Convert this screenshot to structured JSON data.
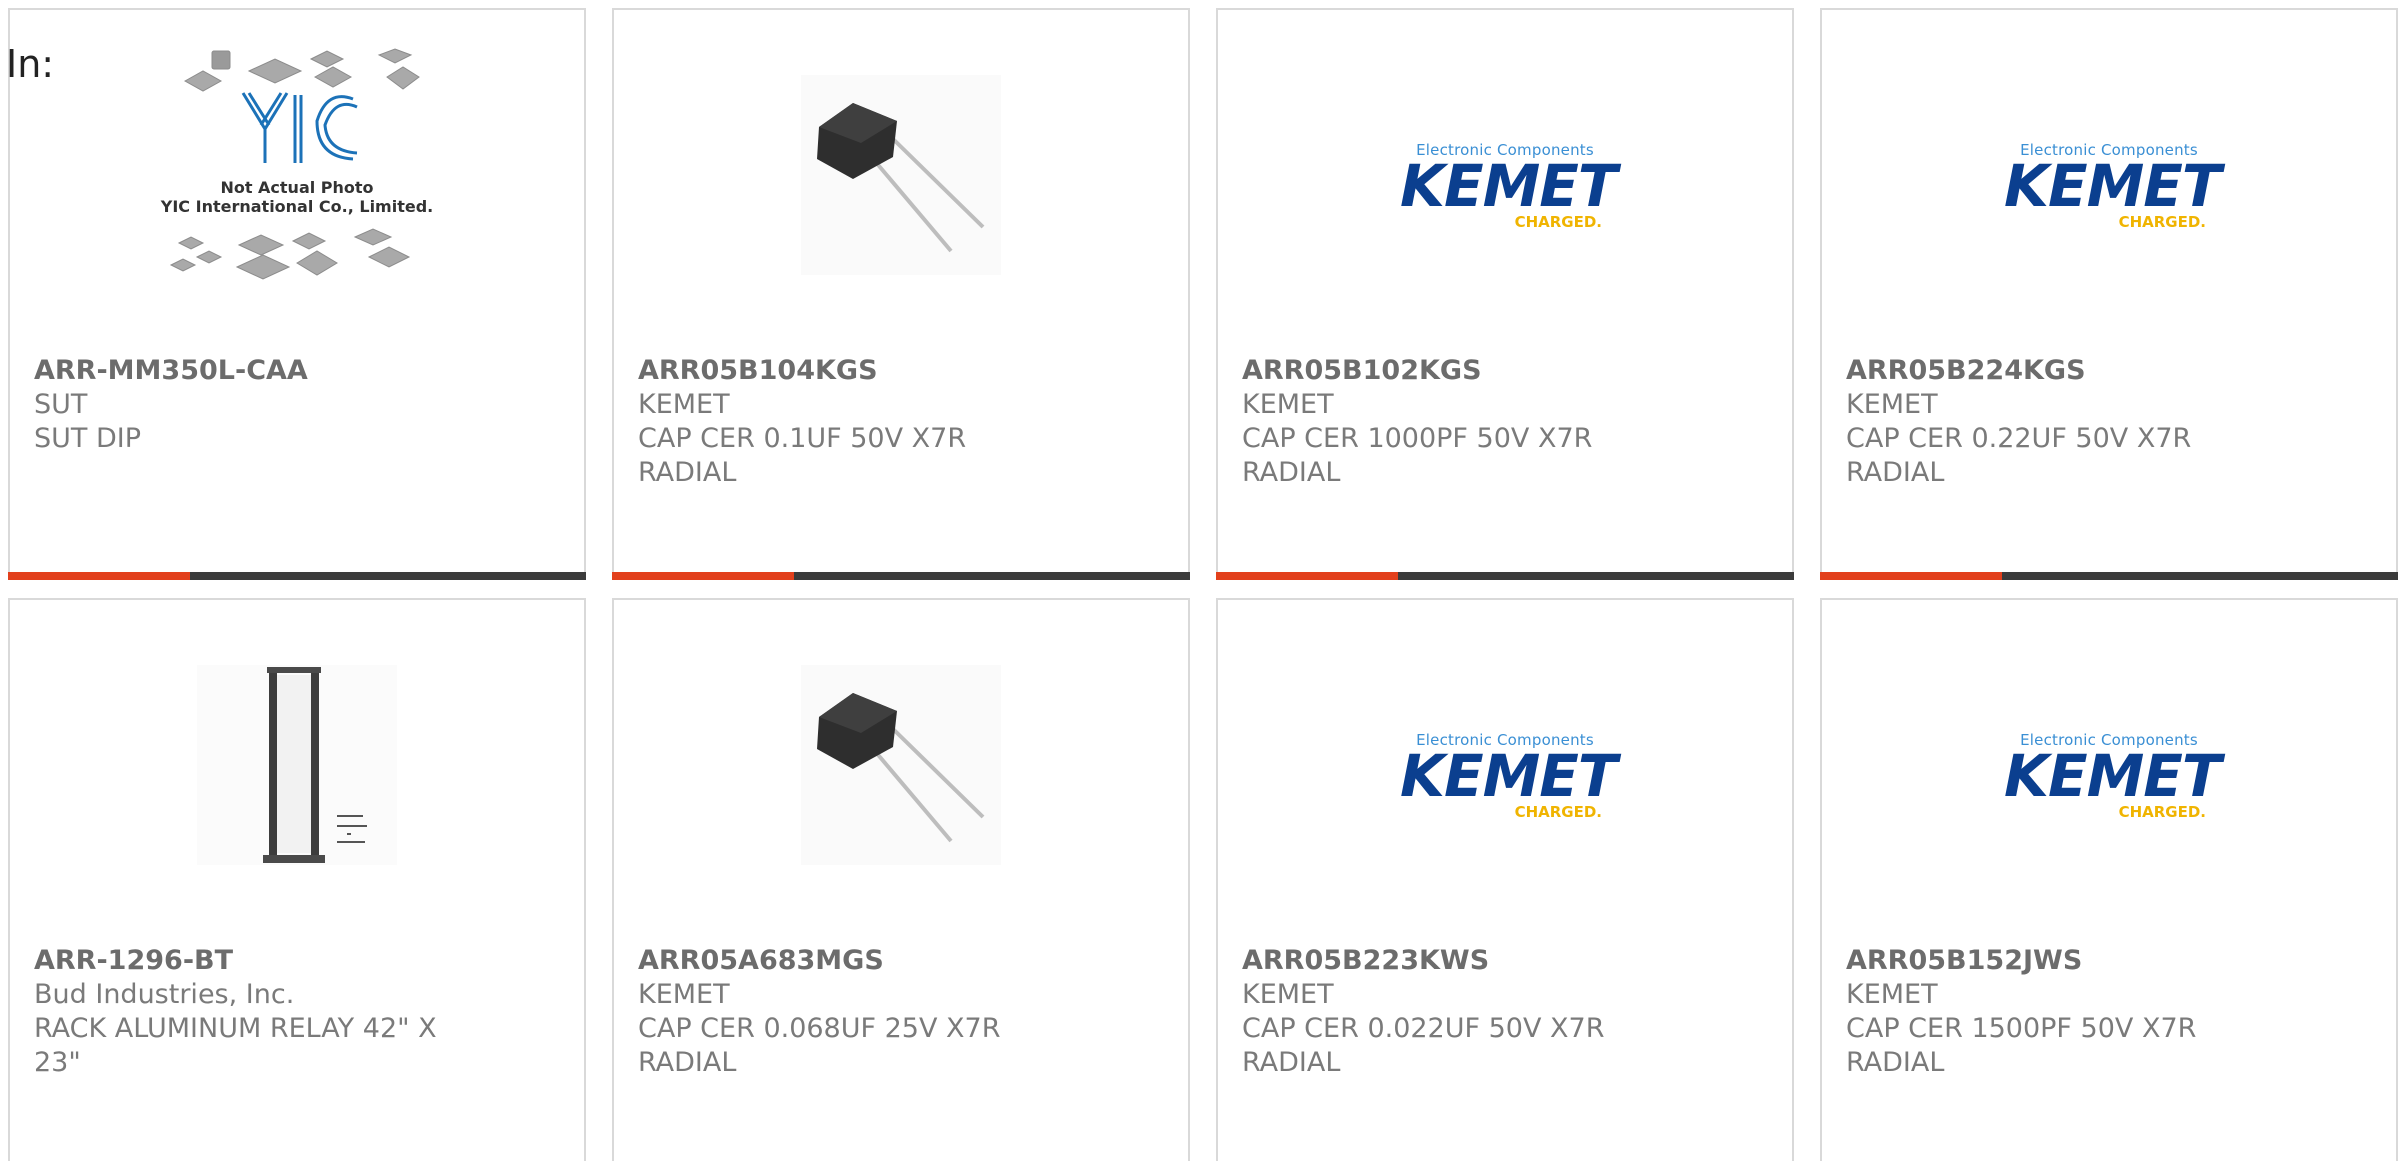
{
  "header": {
    "in_label": "In:"
  },
  "kemet_logo": {
    "tagline": "Electronic Components",
    "brand": "KEMET",
    "slogan": "CHARGED."
  },
  "yic_logo": {
    "brand": "YIC",
    "line1": "Not Actual Photo",
    "line2": "YIC International Co., Limited."
  },
  "colors": {
    "accent": "#e2401c",
    "bar_dark": "#3b3b3b",
    "border": "#d9d9d9",
    "text": "#7a7a7a"
  },
  "products": [
    {
      "part_number": "ARR-MM350L-CAA",
      "manufacturer": "SUT",
      "description": "SUT DIP",
      "image": "yic-placeholder-image"
    },
    {
      "part_number": "ARR05B104KGS",
      "manufacturer": "KEMET",
      "description": "CAP CER 0.1UF 50V X7R RADIAL",
      "image": "capacitor-image"
    },
    {
      "part_number": "ARR05B102KGS",
      "manufacturer": "KEMET",
      "description": "CAP CER 1000PF 50V X7R RADIAL",
      "image": "kemet-logo-image"
    },
    {
      "part_number": "ARR05B224KGS",
      "manufacturer": "KEMET",
      "description": "CAP CER 0.22UF 50V X7R RADIAL",
      "image": "kemet-logo-image"
    },
    {
      "part_number": "ARR-1296-BT",
      "manufacturer": "Bud Industries, Inc.",
      "description": "RACK ALUMINUM RELAY 42\" X 23\"",
      "image": "rack-image"
    },
    {
      "part_number": "ARR05A683MGS",
      "manufacturer": "KEMET",
      "description": "CAP CER 0.068UF 25V X7R RADIAL",
      "image": "capacitor-image"
    },
    {
      "part_number": "ARR05B223KWS",
      "manufacturer": "KEMET",
      "description": "CAP CER 0.022UF 50V X7R RADIAL",
      "image": "kemet-logo-image"
    },
    {
      "part_number": "ARR05B152JWS",
      "manufacturer": "KEMET",
      "description": "CAP CER 1500PF 50V X7R RADIAL",
      "image": "kemet-logo-image"
    }
  ]
}
